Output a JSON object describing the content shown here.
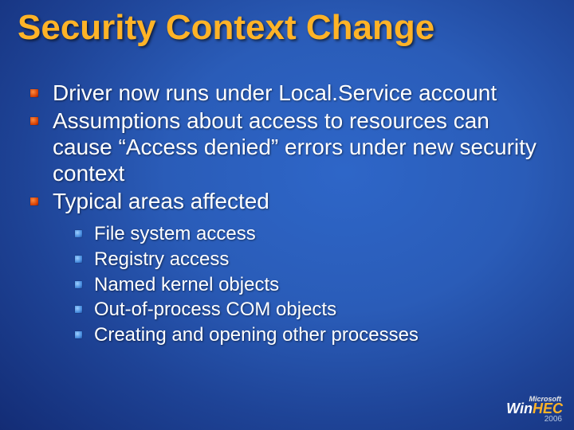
{
  "title": "Security Context Change",
  "bullets": [
    {
      "text": "Driver now runs under Local.Service account"
    },
    {
      "text": "Assumptions about access to resources can cause “Access denied” errors under new security context"
    },
    {
      "text": "Typical areas affected",
      "children": [
        "File system access",
        "Registry access",
        "Named kernel objects",
        "Out-of-process COM objects",
        "Creating and opening other processes"
      ]
    }
  ],
  "logo": {
    "company": "Microsoft",
    "brand_prefix": "Win",
    "brand_suffix": "HEC",
    "year": "2006"
  }
}
